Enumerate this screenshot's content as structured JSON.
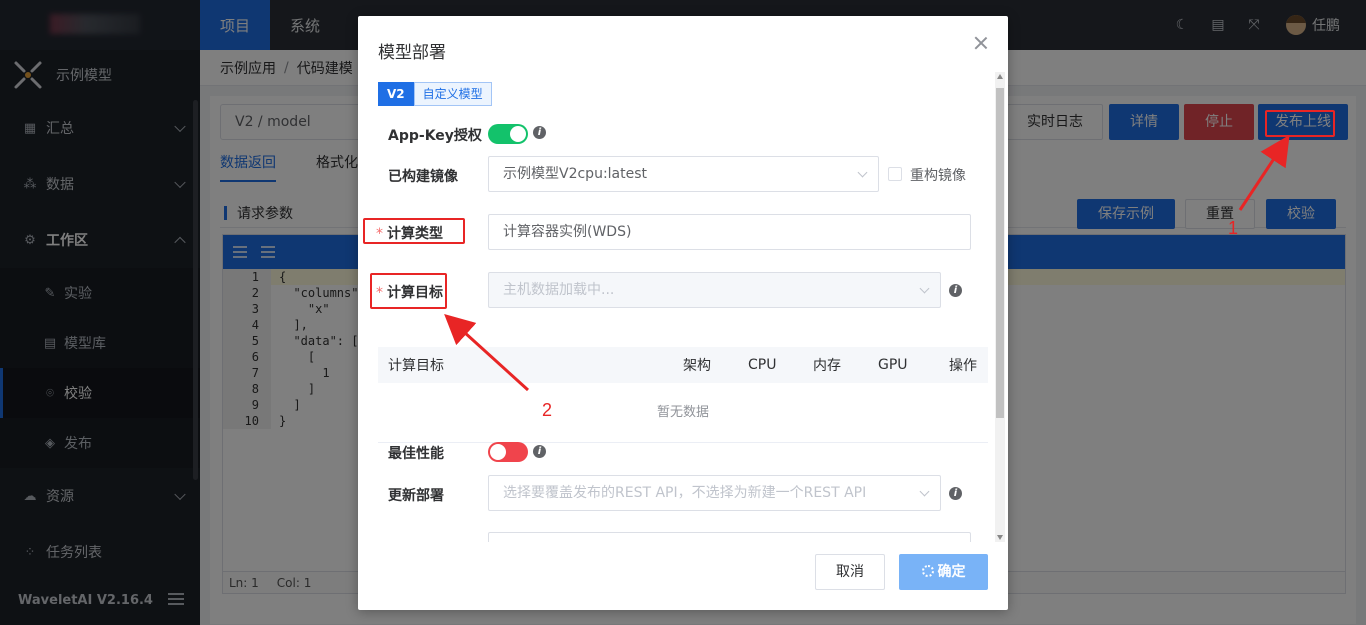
{
  "sidebar": {
    "app_label": "示例模型",
    "items": [
      {
        "label": "汇总",
        "icon": "grid-icon"
      },
      {
        "label": "数据",
        "icon": "data-icon"
      },
      {
        "label": "工作区",
        "icon": "gear-icon"
      }
    ],
    "sub_items": [
      {
        "label": "实验",
        "icon": "experiment-icon"
      },
      {
        "label": "模型库",
        "icon": "model-library-icon"
      },
      {
        "label": "校验",
        "icon": "check-icon"
      },
      {
        "label": "发布",
        "icon": "cube-icon"
      }
    ],
    "items_after": [
      {
        "label": "资源",
        "icon": "resource-icon"
      },
      {
        "label": "任务列表",
        "icon": "task-icon"
      }
    ],
    "version": "WaveletAI V2.16.4"
  },
  "topbar": {
    "nav": [
      "项目",
      "系统"
    ],
    "user_name": "任鹏"
  },
  "breadcrumb": [
    "示例应用",
    "代码建模"
  ],
  "main": {
    "model_select": "V2 / model",
    "buttons": {
      "log": "实时日志",
      "detail": "详情",
      "stop": "停止",
      "publish": "发布上线",
      "save_example": "保存示例",
      "reset": "重置",
      "verify": "校验"
    },
    "tabs": [
      "数据返回",
      "格式化"
    ],
    "request_title": "请求参数",
    "code_lines": [
      {
        "n": "1",
        "text": "{"
      },
      {
        "n": "2",
        "text": "  \"columns\":"
      },
      {
        "n": "3",
        "text": "    \"x\""
      },
      {
        "n": "4",
        "text": "  ],"
      },
      {
        "n": "5",
        "text": "  \"data\": ["
      },
      {
        "n": "6",
        "text": "    ["
      },
      {
        "n": "7",
        "text": "      1"
      },
      {
        "n": "8",
        "text": "    ]"
      },
      {
        "n": "9",
        "text": "  ]"
      },
      {
        "n": "10",
        "text": "}"
      }
    ],
    "status_ln": "Ln: 1",
    "status_col": "Col: 1"
  },
  "dialog": {
    "title": "模型部署",
    "version_tabs": [
      "V2",
      "自定义模型"
    ],
    "app_key_label": "App-Key授权",
    "image_label": "已构建镜像",
    "image_value": "示例模型V2cpu:latest",
    "rebuild_label": "重构镜像",
    "compute_type_label": "计算类型",
    "compute_type_value": "计算容器实例(WDS)",
    "compute_target_label": "计算目标",
    "compute_target_placeholder": "主机数据加载中...",
    "table_headers": [
      "计算目标",
      "架构",
      "CPU",
      "内存",
      "GPU",
      "操作"
    ],
    "table_empty": "暂无数据",
    "best_perf_label": "最佳性能",
    "update_label": "更新部署",
    "update_placeholder": "选择要覆盖发布的REST API，不选择为新建一个REST API",
    "cancel": "取消",
    "confirm": "确定"
  },
  "annotations": [
    "1",
    "2"
  ],
  "colors": {
    "accent": "#1f6fe5",
    "danger": "#e0474f",
    "switch_on": "#13c26b",
    "switch_off": "#f0444c",
    "annotation": "#e82525"
  }
}
